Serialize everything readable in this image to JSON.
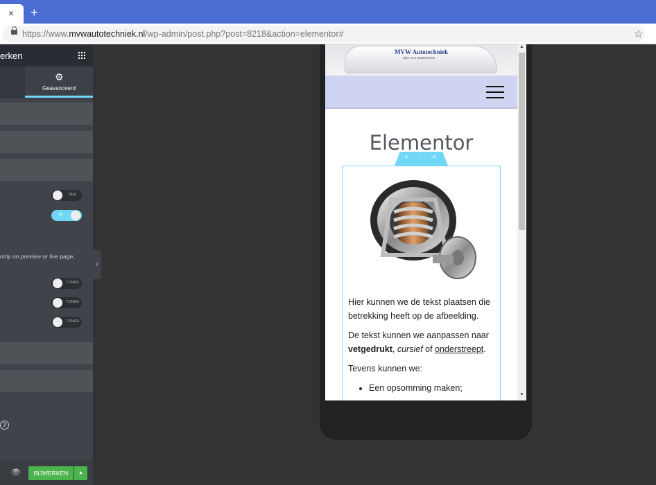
{
  "browser": {
    "tab_close": "×",
    "new_tab": "+",
    "url_prefix": "https://www.",
    "url_domain": "mvwautotechniek.nl",
    "url_path": "/wp-admin/post.php?post=8218&action=elementor#",
    "star": "☆"
  },
  "panel": {
    "title": "erken",
    "advanced_tab": "Geavanceerd",
    "toggles": [
      {
        "label": "NEE",
        "state": "off"
      },
      {
        "label": "JA",
        "state": "on"
      },
      {
        "label": "TONEN",
        "state": "off"
      },
      {
        "label": "TONEN",
        "state": "off"
      },
      {
        "label": "TONEN",
        "state": "off"
      }
    ],
    "note": "only on preview or live page,",
    "help": "?",
    "footer": {
      "update_label": "BIJWERKEN",
      "arrow": "▲"
    }
  },
  "preview": {
    "brand": "MVW Autotechniek",
    "brand_sub": "alles voor autotechniek",
    "heading": "Elementor",
    "widget_tools": {
      "add": "+",
      "move": "⋮⋮⋮",
      "remove": "×"
    },
    "para1": "Hier kunnen we de tekst plaatsen die betrekking heeft op de afbeelding.",
    "para2_a": "De tekst kunnen we aanpassen naar ",
    "para2_bold": "vetgedrukt",
    "para2_b": ", ",
    "para2_italic": "cursief",
    "para2_c": " of ",
    "para2_under": "onderstreept",
    "para2_d": ".",
    "para3": "Tevens kunnen we:",
    "list": [
      "Een opsomming maken;"
    ]
  },
  "colors": {
    "accent": "#71d7f7",
    "update_green": "#4cb44c",
    "browser_blue": "#4a6cd3",
    "nav_lilac": "#cfd4f2"
  }
}
